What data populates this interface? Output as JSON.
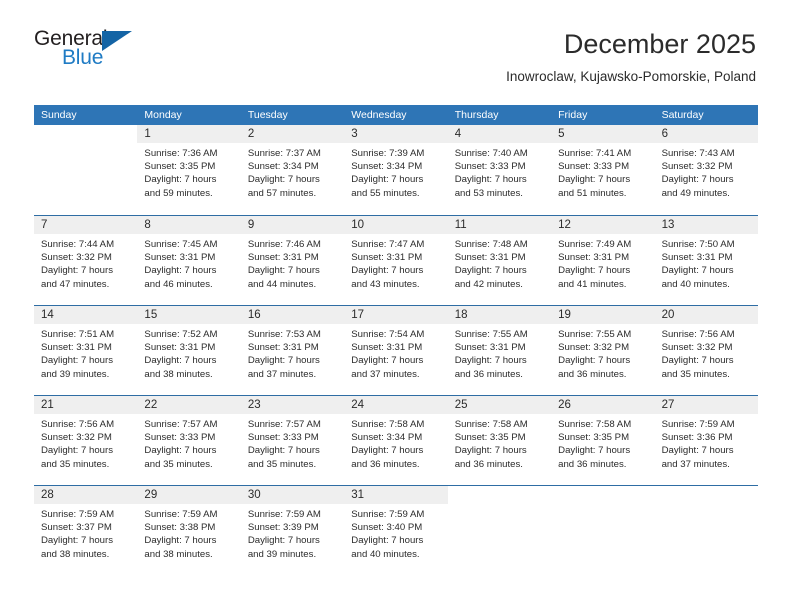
{
  "brand": {
    "name_part1": "General",
    "name_part2": "Blue",
    "triangle_icon": "triangle-icon",
    "accent_color": "#1f7bc4",
    "triangle_color": "#1464a5"
  },
  "header": {
    "title": "December 2025",
    "location": "Inowroclaw, Kujawsko-Pomorskie, Poland"
  },
  "calendar": {
    "header_bg": "#2e75b6",
    "row_divider_color": "#2e6da4",
    "daynum_bg": "#efefef",
    "weekdays": [
      "Sunday",
      "Monday",
      "Tuesday",
      "Wednesday",
      "Thursday",
      "Friday",
      "Saturday"
    ],
    "weeks": [
      [
        {
          "day": "",
          "empty": true,
          "sunrise": "",
          "sunset": "",
          "daylight1": "",
          "daylight2": ""
        },
        {
          "day": "1",
          "empty": false,
          "sunrise": "Sunrise: 7:36 AM",
          "sunset": "Sunset: 3:35 PM",
          "daylight1": "Daylight: 7 hours",
          "daylight2": "and 59 minutes."
        },
        {
          "day": "2",
          "empty": false,
          "sunrise": "Sunrise: 7:37 AM",
          "sunset": "Sunset: 3:34 PM",
          "daylight1": "Daylight: 7 hours",
          "daylight2": "and 57 minutes."
        },
        {
          "day": "3",
          "empty": false,
          "sunrise": "Sunrise: 7:39 AM",
          "sunset": "Sunset: 3:34 PM",
          "daylight1": "Daylight: 7 hours",
          "daylight2": "and 55 minutes."
        },
        {
          "day": "4",
          "empty": false,
          "sunrise": "Sunrise: 7:40 AM",
          "sunset": "Sunset: 3:33 PM",
          "daylight1": "Daylight: 7 hours",
          "daylight2": "and 53 minutes."
        },
        {
          "day": "5",
          "empty": false,
          "sunrise": "Sunrise: 7:41 AM",
          "sunset": "Sunset: 3:33 PM",
          "daylight1": "Daylight: 7 hours",
          "daylight2": "and 51 minutes."
        },
        {
          "day": "6",
          "empty": false,
          "sunrise": "Sunrise: 7:43 AM",
          "sunset": "Sunset: 3:32 PM",
          "daylight1": "Daylight: 7 hours",
          "daylight2": "and 49 minutes."
        }
      ],
      [
        {
          "day": "7",
          "empty": false,
          "sunrise": "Sunrise: 7:44 AM",
          "sunset": "Sunset: 3:32 PM",
          "daylight1": "Daylight: 7 hours",
          "daylight2": "and 47 minutes."
        },
        {
          "day": "8",
          "empty": false,
          "sunrise": "Sunrise: 7:45 AM",
          "sunset": "Sunset: 3:31 PM",
          "daylight1": "Daylight: 7 hours",
          "daylight2": "and 46 minutes."
        },
        {
          "day": "9",
          "empty": false,
          "sunrise": "Sunrise: 7:46 AM",
          "sunset": "Sunset: 3:31 PM",
          "daylight1": "Daylight: 7 hours",
          "daylight2": "and 44 minutes."
        },
        {
          "day": "10",
          "empty": false,
          "sunrise": "Sunrise: 7:47 AM",
          "sunset": "Sunset: 3:31 PM",
          "daylight1": "Daylight: 7 hours",
          "daylight2": "and 43 minutes."
        },
        {
          "day": "11",
          "empty": false,
          "sunrise": "Sunrise: 7:48 AM",
          "sunset": "Sunset: 3:31 PM",
          "daylight1": "Daylight: 7 hours",
          "daylight2": "and 42 minutes."
        },
        {
          "day": "12",
          "empty": false,
          "sunrise": "Sunrise: 7:49 AM",
          "sunset": "Sunset: 3:31 PM",
          "daylight1": "Daylight: 7 hours",
          "daylight2": "and 41 minutes."
        },
        {
          "day": "13",
          "empty": false,
          "sunrise": "Sunrise: 7:50 AM",
          "sunset": "Sunset: 3:31 PM",
          "daylight1": "Daylight: 7 hours",
          "daylight2": "and 40 minutes."
        }
      ],
      [
        {
          "day": "14",
          "empty": false,
          "sunrise": "Sunrise: 7:51 AM",
          "sunset": "Sunset: 3:31 PM",
          "daylight1": "Daylight: 7 hours",
          "daylight2": "and 39 minutes."
        },
        {
          "day": "15",
          "empty": false,
          "sunrise": "Sunrise: 7:52 AM",
          "sunset": "Sunset: 3:31 PM",
          "daylight1": "Daylight: 7 hours",
          "daylight2": "and 38 minutes."
        },
        {
          "day": "16",
          "empty": false,
          "sunrise": "Sunrise: 7:53 AM",
          "sunset": "Sunset: 3:31 PM",
          "daylight1": "Daylight: 7 hours",
          "daylight2": "and 37 minutes."
        },
        {
          "day": "17",
          "empty": false,
          "sunrise": "Sunrise: 7:54 AM",
          "sunset": "Sunset: 3:31 PM",
          "daylight1": "Daylight: 7 hours",
          "daylight2": "and 37 minutes."
        },
        {
          "day": "18",
          "empty": false,
          "sunrise": "Sunrise: 7:55 AM",
          "sunset": "Sunset: 3:31 PM",
          "daylight1": "Daylight: 7 hours",
          "daylight2": "and 36 minutes."
        },
        {
          "day": "19",
          "empty": false,
          "sunrise": "Sunrise: 7:55 AM",
          "sunset": "Sunset: 3:32 PM",
          "daylight1": "Daylight: 7 hours",
          "daylight2": "and 36 minutes."
        },
        {
          "day": "20",
          "empty": false,
          "sunrise": "Sunrise: 7:56 AM",
          "sunset": "Sunset: 3:32 PM",
          "daylight1": "Daylight: 7 hours",
          "daylight2": "and 35 minutes."
        }
      ],
      [
        {
          "day": "21",
          "empty": false,
          "sunrise": "Sunrise: 7:56 AM",
          "sunset": "Sunset: 3:32 PM",
          "daylight1": "Daylight: 7 hours",
          "daylight2": "and 35 minutes."
        },
        {
          "day": "22",
          "empty": false,
          "sunrise": "Sunrise: 7:57 AM",
          "sunset": "Sunset: 3:33 PM",
          "daylight1": "Daylight: 7 hours",
          "daylight2": "and 35 minutes."
        },
        {
          "day": "23",
          "empty": false,
          "sunrise": "Sunrise: 7:57 AM",
          "sunset": "Sunset: 3:33 PM",
          "daylight1": "Daylight: 7 hours",
          "daylight2": "and 35 minutes."
        },
        {
          "day": "24",
          "empty": false,
          "sunrise": "Sunrise: 7:58 AM",
          "sunset": "Sunset: 3:34 PM",
          "daylight1": "Daylight: 7 hours",
          "daylight2": "and 36 minutes."
        },
        {
          "day": "25",
          "empty": false,
          "sunrise": "Sunrise: 7:58 AM",
          "sunset": "Sunset: 3:35 PM",
          "daylight1": "Daylight: 7 hours",
          "daylight2": "and 36 minutes."
        },
        {
          "day": "26",
          "empty": false,
          "sunrise": "Sunrise: 7:58 AM",
          "sunset": "Sunset: 3:35 PM",
          "daylight1": "Daylight: 7 hours",
          "daylight2": "and 36 minutes."
        },
        {
          "day": "27",
          "empty": false,
          "sunrise": "Sunrise: 7:59 AM",
          "sunset": "Sunset: 3:36 PM",
          "daylight1": "Daylight: 7 hours",
          "daylight2": "and 37 minutes."
        }
      ],
      [
        {
          "day": "28",
          "empty": false,
          "sunrise": "Sunrise: 7:59 AM",
          "sunset": "Sunset: 3:37 PM",
          "daylight1": "Daylight: 7 hours",
          "daylight2": "and 38 minutes."
        },
        {
          "day": "29",
          "empty": false,
          "sunrise": "Sunrise: 7:59 AM",
          "sunset": "Sunset: 3:38 PM",
          "daylight1": "Daylight: 7 hours",
          "daylight2": "and 38 minutes."
        },
        {
          "day": "30",
          "empty": false,
          "sunrise": "Sunrise: 7:59 AM",
          "sunset": "Sunset: 3:39 PM",
          "daylight1": "Daylight: 7 hours",
          "daylight2": "and 39 minutes."
        },
        {
          "day": "31",
          "empty": false,
          "sunrise": "Sunrise: 7:59 AM",
          "sunset": "Sunset: 3:40 PM",
          "daylight1": "Daylight: 7 hours",
          "daylight2": "and 40 minutes."
        },
        {
          "day": "",
          "empty": true,
          "sunrise": "",
          "sunset": "",
          "daylight1": "",
          "daylight2": ""
        },
        {
          "day": "",
          "empty": true,
          "sunrise": "",
          "sunset": "",
          "daylight1": "",
          "daylight2": ""
        },
        {
          "day": "",
          "empty": true,
          "sunrise": "",
          "sunset": "",
          "daylight1": "",
          "daylight2": ""
        }
      ]
    ]
  }
}
